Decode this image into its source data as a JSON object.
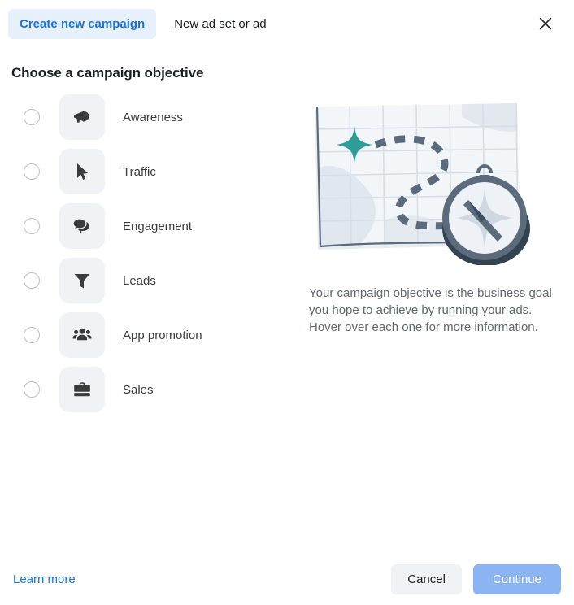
{
  "header": {
    "tabs": [
      {
        "label": "Create new campaign",
        "active": true
      },
      {
        "label": "New ad set or ad",
        "active": false
      }
    ],
    "close_label": "Close"
  },
  "main": {
    "section_title": "Choose a campaign objective",
    "objectives": [
      {
        "label": "Awareness",
        "icon": "megaphone-icon",
        "selected": false
      },
      {
        "label": "Traffic",
        "icon": "cursor-icon",
        "selected": false
      },
      {
        "label": "Engagement",
        "icon": "chat-bubbles-icon",
        "selected": false
      },
      {
        "label": "Leads",
        "icon": "funnel-icon",
        "selected": false
      },
      {
        "label": "App promotion",
        "icon": "people-icon",
        "selected": false
      },
      {
        "label": "Sales",
        "icon": "briefcase-icon",
        "selected": false
      }
    ],
    "illustration_name": "map-with-compass-illustration",
    "helper_text": "Your campaign objective is the business goal you hope to achieve by running your ads. Hover over each one for more information."
  },
  "footer": {
    "learn_more": "Learn more",
    "cancel": "Cancel",
    "continue": "Continue"
  },
  "colors": {
    "accent_blue": "#1b74e4",
    "active_tab_bg": "#e7f0fd",
    "tile_bg": "#f0f2f5",
    "continue_disabled": "#8ab4f2",
    "star_teal": "#2d9d96",
    "map_line": "#5b6b7c",
    "text_secondary": "#606770"
  }
}
